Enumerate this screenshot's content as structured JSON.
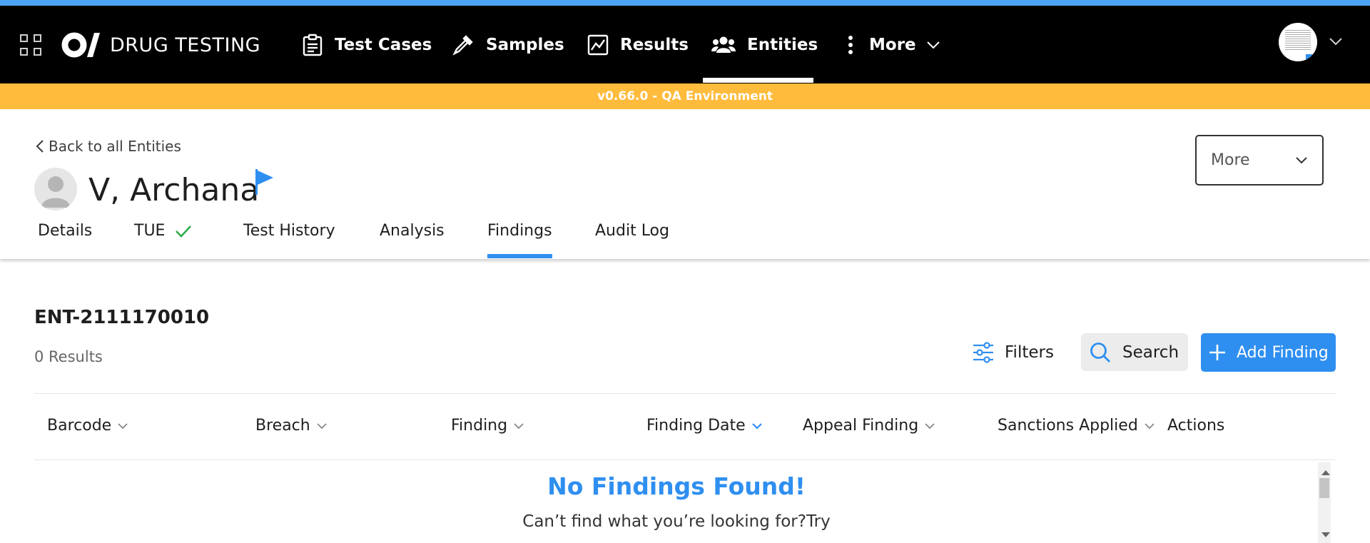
{
  "brand": {
    "title": "DRUG TESTING"
  },
  "nav": {
    "items": [
      {
        "label": "Test Cases"
      },
      {
        "label": "Samples"
      },
      {
        "label": "Results"
      },
      {
        "label": "Entities"
      },
      {
        "label": "More"
      }
    ],
    "active": "Entities"
  },
  "env_banner": "v0.66.0 - QA Environment",
  "entity": {
    "back_label": "Back to all Entities",
    "name": "V, Archana",
    "more_label": "More",
    "tabs": [
      {
        "label": "Details"
      },
      {
        "label": "TUE"
      },
      {
        "label": "Test History"
      },
      {
        "label": "Analysis"
      },
      {
        "label": "Findings"
      },
      {
        "label": "Audit Log"
      }
    ],
    "active_tab": "Findings"
  },
  "findings": {
    "entity_id": "ENT-2111170010",
    "results_count": "0 Results",
    "filters_label": "Filters",
    "search_label": "Search",
    "add_label": "Add Finding",
    "columns": [
      {
        "label": "Barcode"
      },
      {
        "label": "Breach"
      },
      {
        "label": "Finding"
      },
      {
        "label": "Finding Date"
      },
      {
        "label": "Appeal Finding"
      },
      {
        "label": "Sanctions Applied"
      },
      {
        "label": "Actions"
      }
    ],
    "empty_title": "No Findings Found!",
    "empty_subtitle": "Can’t find what you’re looking for?Try"
  },
  "icons": {
    "apps": "grid-icon",
    "test_cases": "clipboard-icon",
    "samples": "pipette-icon",
    "results": "chart-icon",
    "entities": "users-icon",
    "more": "dots-vertical-icon",
    "flag": "flag-icon",
    "tue_status": "check-icon"
  },
  "colors": {
    "accent": "#2f8ff0",
    "banner": "#ffbb3c",
    "navbar": "#000000",
    "top_strip": "#4da3f5",
    "success": "#2faa4a"
  }
}
